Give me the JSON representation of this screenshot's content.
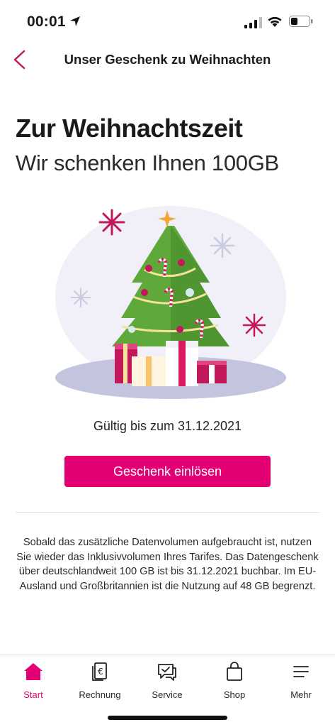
{
  "status_bar": {
    "time": "00:01"
  },
  "nav": {
    "title": "Unser Geschenk zu Weihnachten",
    "accent_color": "#e20074"
  },
  "hero": {
    "headline": "Zur Weihnachtszeit",
    "subline": "Wir schenken Ihnen 100GB"
  },
  "offer": {
    "valid_text": "Gültig bis zum 31.12.2021",
    "button_label": "Geschenk einlösen",
    "info_text": "Sobald das zusätzliche Datenvolumen aufgebraucht ist, nutzen Sie wieder das Inklusivvolumen Ihres Tarifes. Das Datengeschenk über deutschlandweit 100 GB ist bis 31.12.2021 buchbar. Im EU-Ausland und Großbritannien ist die Nutzung auf 48 GB begrenzt."
  },
  "tab_bar": {
    "tabs": [
      {
        "label": "Start",
        "icon": "home-icon",
        "active": true
      },
      {
        "label": "Rechnung",
        "icon": "invoice-icon",
        "active": false
      },
      {
        "label": "Service",
        "icon": "service-chat-icon",
        "active": false
      },
      {
        "label": "Shop",
        "icon": "shopping-bag-icon",
        "active": false
      },
      {
        "label": "Mehr",
        "icon": "menu-icon",
        "active": false
      }
    ]
  },
  "colors": {
    "brand_magenta": "#e20074",
    "tree_green": "#5fa83a",
    "star_orange": "#f3a534"
  }
}
